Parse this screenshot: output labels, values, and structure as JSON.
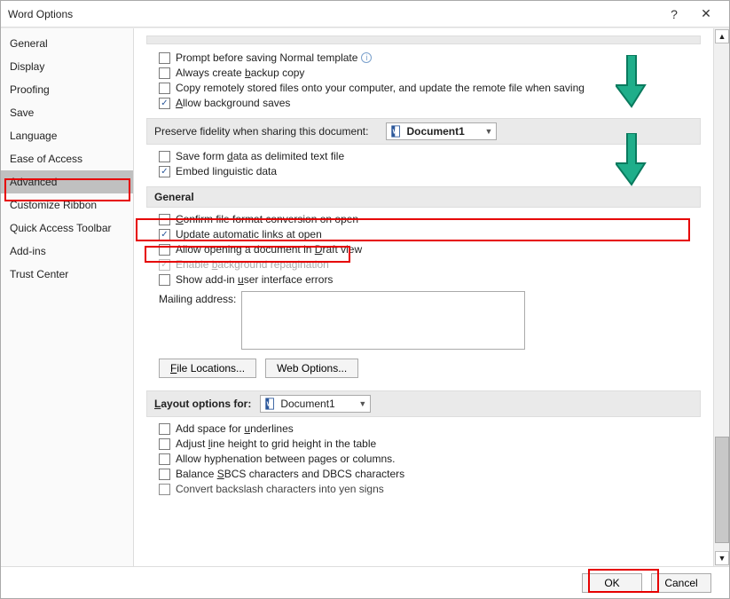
{
  "title": "Word Options",
  "sidebar": {
    "items": [
      {
        "label": "General"
      },
      {
        "label": "Display"
      },
      {
        "label": "Proofing"
      },
      {
        "label": "Save"
      },
      {
        "label": "Language"
      },
      {
        "label": "Ease of Access"
      },
      {
        "label": "Advanced",
        "active": true
      },
      {
        "label": "Customize Ribbon"
      },
      {
        "label": "Quick Access Toolbar"
      },
      {
        "label": "Add-ins"
      },
      {
        "label": "Trust Center"
      }
    ]
  },
  "content": {
    "top_checks": [
      {
        "label": "Prompt before saving Normal template",
        "checked": false,
        "info": true,
        "u": ""
      },
      {
        "label": "Always create backup copy",
        "checked": false,
        "u": "b"
      },
      {
        "label": "Copy remotely stored files onto your computer, and update the remote file when saving",
        "checked": false,
        "u": ""
      },
      {
        "label": "Allow background saves",
        "checked": true,
        "u": "A"
      }
    ],
    "fidelity": {
      "header": "Preserve fidelity when sharing this document:",
      "document": "Document1",
      "checks": [
        {
          "label": "Save form data as delimited text file",
          "checked": false,
          "u": "d"
        },
        {
          "label": "Embed linguistic data",
          "checked": true
        }
      ]
    },
    "general": {
      "header": "General",
      "checks": [
        {
          "label": "Confirm file format conversion on open",
          "checked": false,
          "u": "C"
        },
        {
          "label": "Update automatic links at open",
          "checked": true
        },
        {
          "label": "Allow opening a document in Draft view",
          "checked": false,
          "u": "D"
        },
        {
          "label": "Enable background repagination",
          "checked": true,
          "disabled": true,
          "u": "b"
        },
        {
          "label": "Show add-in user interface errors",
          "checked": false,
          "u": "u"
        }
      ],
      "mailing_label": "Mailing address:",
      "mailing_value": "",
      "file_locations_btn": "File Locations...",
      "web_options_btn": "Web Options..."
    },
    "layout": {
      "header": "Layout options for:",
      "document": "Document1",
      "checks": [
        {
          "label": "Add space for underlines",
          "checked": false,
          "u": "u"
        },
        {
          "label": "Adjust line height to grid height in the table",
          "checked": false,
          "u": "l"
        },
        {
          "label": "Allow hyphenation between pages or columns.",
          "checked": false
        },
        {
          "label": "Balance SBCS characters and DBCS characters",
          "checked": false,
          "u": "S"
        },
        {
          "label": "Convert backslash characters into yen signs",
          "checked": false
        }
      ]
    }
  },
  "footer": {
    "ok": "OK",
    "cancel": "Cancel"
  }
}
